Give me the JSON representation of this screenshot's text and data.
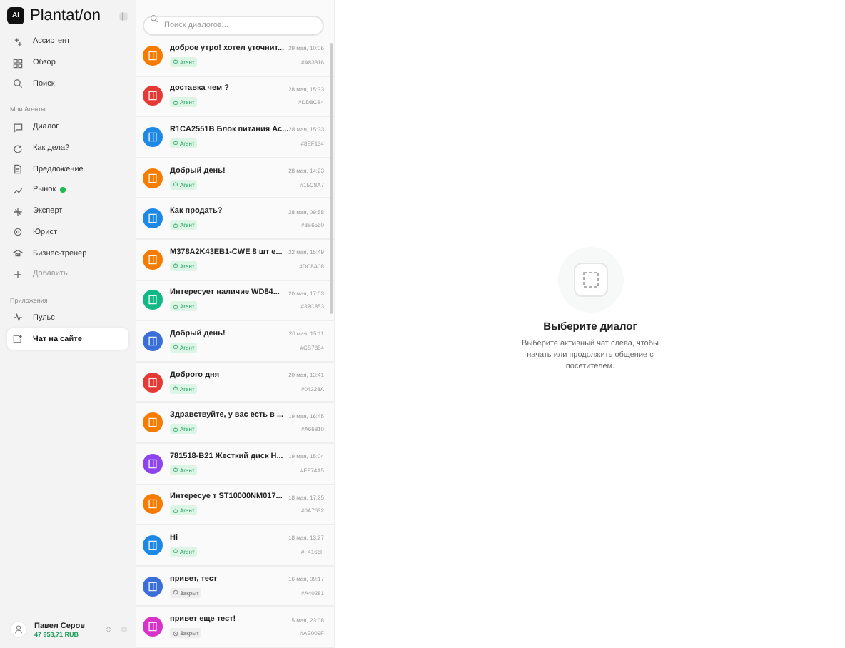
{
  "brand": {
    "mark": "AI",
    "name": "Plantat/on"
  },
  "nav": [
    {
      "label": "Ассистент",
      "selected": false
    },
    {
      "label": "Обзор",
      "selected": false
    },
    {
      "label": "Поиск",
      "selected": false
    }
  ],
  "sections": [
    {
      "title": "Мои Агенты",
      "items": [
        {
          "label": "Диалог",
          "selected": false,
          "dot": false,
          "muted": false
        },
        {
          "label": "Как дела?",
          "selected": false,
          "dot": false,
          "muted": false
        },
        {
          "label": "Предложение",
          "selected": false,
          "dot": false,
          "muted": false
        },
        {
          "label": "Рынок",
          "selected": false,
          "dot": true,
          "muted": false
        },
        {
          "label": "Эксперт",
          "selected": false,
          "dot": false,
          "muted": false
        },
        {
          "label": "Юрист",
          "selected": false,
          "dot": false,
          "muted": false
        },
        {
          "label": "Бизнес-тренер",
          "selected": false,
          "dot": false,
          "muted": false
        },
        {
          "label": "Добавить",
          "selected": false,
          "dot": false,
          "muted": true
        }
      ]
    },
    {
      "title": "Приложения",
      "items": [
        {
          "label": "Пульс",
          "selected": false,
          "dot": false,
          "muted": false
        },
        {
          "label": "Чат на сайте",
          "selected": true,
          "dot": false,
          "muted": false
        }
      ]
    }
  ],
  "user": {
    "name": "Павел Серов",
    "balance": "47 953,71 RUB"
  },
  "search": {
    "placeholder": "Поиск диалогов..."
  },
  "dialogs": [
    {
      "title": "доброе утро! хотел уточнит...",
      "date": "29 мая, 10:06",
      "id": "#A83816",
      "color": "#f57c00",
      "status": {
        "kind": "agent",
        "label": "Агент"
      }
    },
    {
      "title": "доставка чем ?",
      "date": "28 мая, 15:33",
      "id": "#DD8CB4",
      "color": "#e53935",
      "status": {
        "kind": "agent",
        "label": "Агент"
      }
    },
    {
      "title": "R1CA2551B Блок питания Ас...",
      "date": "28 мая, 15:33",
      "id": "#8EF134",
      "color": "#1e88e5",
      "status": {
        "kind": "agent",
        "label": "Агент"
      }
    },
    {
      "title": "Добрый день!",
      "date": "28 мая, 14:23",
      "id": "#15C8A7",
      "color": "#f57c00",
      "status": {
        "kind": "agent",
        "label": "Агент"
      }
    },
    {
      "title": "Как продать?",
      "date": "28 мая, 09:58",
      "id": "#8B6560",
      "color": "#1e88e5",
      "status": {
        "kind": "agent",
        "label": "Агент"
      }
    },
    {
      "title": "M378A2K43EB1-CWE 8 шт е...",
      "date": "22 мая, 15:49",
      "id": "#DC8A08",
      "color": "#f57c00",
      "status": {
        "kind": "agent",
        "label": "Агент"
      }
    },
    {
      "title": "Интересует наличие WD84...",
      "date": "20 мая, 17:03",
      "id": "#32C853",
      "color": "#12b886",
      "status": {
        "kind": "agent",
        "label": "Агент"
      }
    },
    {
      "title": "Добрый день!",
      "date": "20 мая, 15:11",
      "id": "#CB7854",
      "color": "#3b6fd8",
      "status": {
        "kind": "agent",
        "label": "Агент"
      }
    },
    {
      "title": "Доброго дня",
      "date": "20 мая, 13:41",
      "id": "#04228A",
      "color": "#e53935",
      "status": {
        "kind": "agent",
        "label": "Агент"
      }
    },
    {
      "title": "Здравствуйте, у вас есть в ...",
      "date": "19 мая, 16:45",
      "id": "#A66810",
      "color": "#f57c00",
      "status": {
        "kind": "agent",
        "label": "Агент"
      }
    },
    {
      "title": "781518-B21 Жесткий диск H...",
      "date": "19 мая, 15:04",
      "id": "#E874A5",
      "color": "#8e44ec",
      "status": {
        "kind": "agent",
        "label": "Агент"
      }
    },
    {
      "title": "Интересуе т ST10000NM017...",
      "date": "18 мая, 17:25",
      "id": "#0A7632",
      "color": "#f57c00",
      "status": {
        "kind": "agent",
        "label": "Агент"
      }
    },
    {
      "title": "Hi",
      "date": "18 мая, 13:27",
      "id": "#F4166F",
      "color": "#1e88e5",
      "status": {
        "kind": "agent",
        "label": "Агент"
      }
    },
    {
      "title": "привет, тест",
      "date": "16 мая, 09:17",
      "id": "#A40281",
      "color": "#3b6fd8",
      "status": {
        "kind": "closed",
        "label": "Закрыт"
      }
    },
    {
      "title": "привет еще тест!",
      "date": "15 мая, 23:08",
      "id": "#AE009F",
      "color": "#d633c8",
      "status": {
        "kind": "closed",
        "label": "Закрыт"
      }
    }
  ],
  "empty": {
    "title": "Выберите диалог",
    "text": "Выберите активный чат слева, чтобы начать или продолжить общение с посетителем."
  }
}
